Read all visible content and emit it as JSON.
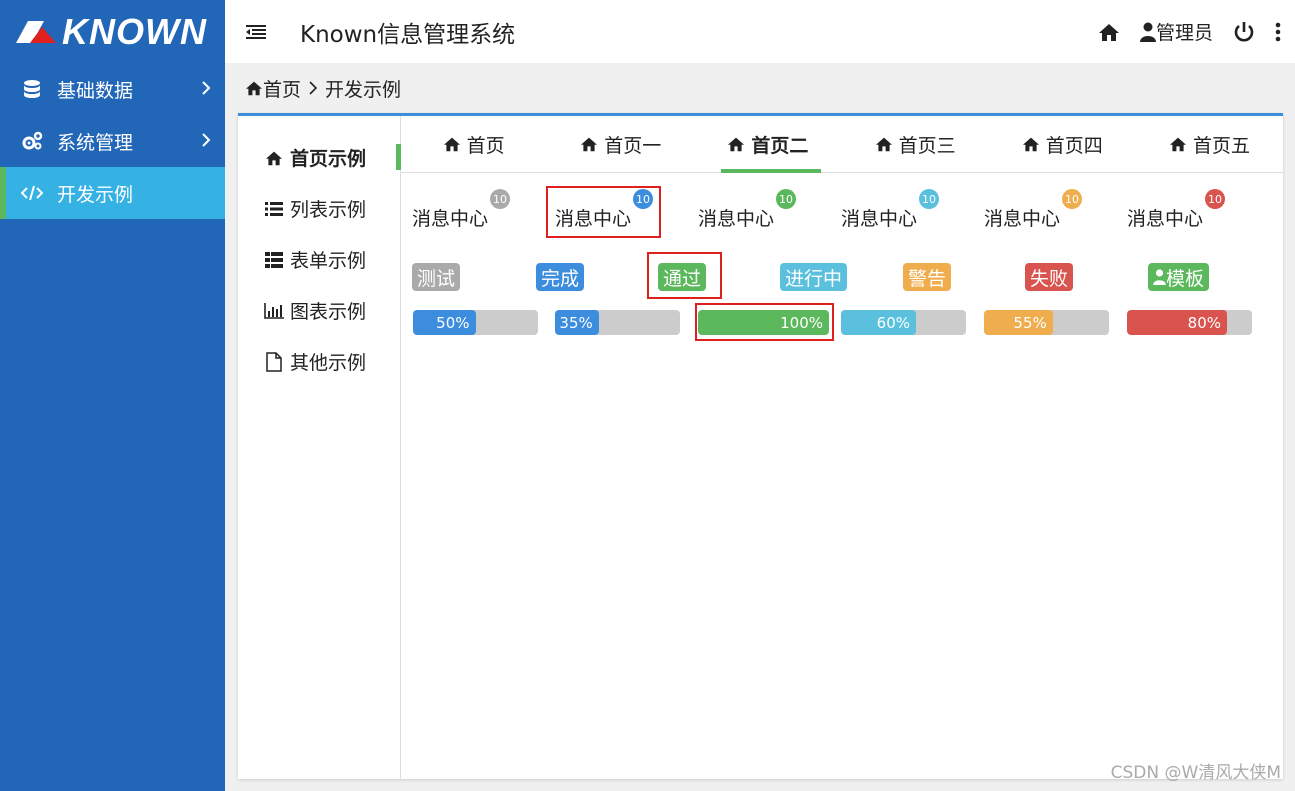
{
  "app": {
    "logo": "KNOWN",
    "title": "Known信息管理系统"
  },
  "sidebar": {
    "items": [
      {
        "label": "基础数据",
        "icon": "database-icon",
        "has_children": true
      },
      {
        "label": "系统管理",
        "icon": "cogs-icon",
        "has_children": true
      },
      {
        "label": "开发示例",
        "icon": "code-icon",
        "has_children": false,
        "active": true
      }
    ]
  },
  "header": {
    "user": "管理员"
  },
  "breadcrumb": {
    "home": "首页",
    "current": "开发示例"
  },
  "left_tabs": [
    {
      "label": "首页示例",
      "icon": "home-icon",
      "active": true
    },
    {
      "label": "列表示例",
      "icon": "list-icon"
    },
    {
      "label": "表单示例",
      "icon": "form-list-icon"
    },
    {
      "label": "图表示例",
      "icon": "bar-chart-icon"
    },
    {
      "label": "其他示例",
      "icon": "file-icon"
    }
  ],
  "top_tabs": [
    {
      "label": "首页"
    },
    {
      "label": "首页一"
    },
    {
      "label": "首页二",
      "active": true
    },
    {
      "label": "首页三"
    },
    {
      "label": "首页四"
    },
    {
      "label": "首页五"
    }
  ],
  "badges": [
    {
      "label": "消息中心",
      "count": "10",
      "color": "#aaaaaa"
    },
    {
      "label": "消息中心",
      "count": "10",
      "color": "#3c8dde"
    },
    {
      "label": "消息中心",
      "count": "10",
      "color": "#5cb85c"
    },
    {
      "label": "消息中心",
      "count": "10",
      "color": "#5bc0de"
    },
    {
      "label": "消息中心",
      "count": "10",
      "color": "#f0ad4e"
    },
    {
      "label": "消息中心",
      "count": "10",
      "color": "#d9534f"
    }
  ],
  "labels": [
    {
      "text": "测试",
      "color": "#aaaaaa"
    },
    {
      "text": "完成",
      "color": "#3c8dde"
    },
    {
      "text": "通过",
      "color": "#5cb85c"
    },
    {
      "text": "进行中",
      "color": "#5bc0de"
    },
    {
      "text": "警告",
      "color": "#f0ad4e"
    },
    {
      "text": "失败",
      "color": "#d9534f"
    },
    {
      "text": "模板",
      "color": "#5cb85c",
      "icon": "user-icon"
    }
  ],
  "progress": [
    {
      "text": "50%",
      "value": 50,
      "color": "#3c8dde"
    },
    {
      "text": "35%",
      "value": 35,
      "color": "#3c8dde"
    },
    {
      "text": "100%",
      "value": 100,
      "color": "#5cb85c"
    },
    {
      "text": "60%",
      "value": 60,
      "color": "#5bc0de"
    },
    {
      "text": "55%",
      "value": 55,
      "color": "#f0ad4e"
    },
    {
      "text": "80%",
      "value": 80,
      "color": "#d9534f"
    }
  ],
  "watermark": "CSDN @W清风大侠M"
}
